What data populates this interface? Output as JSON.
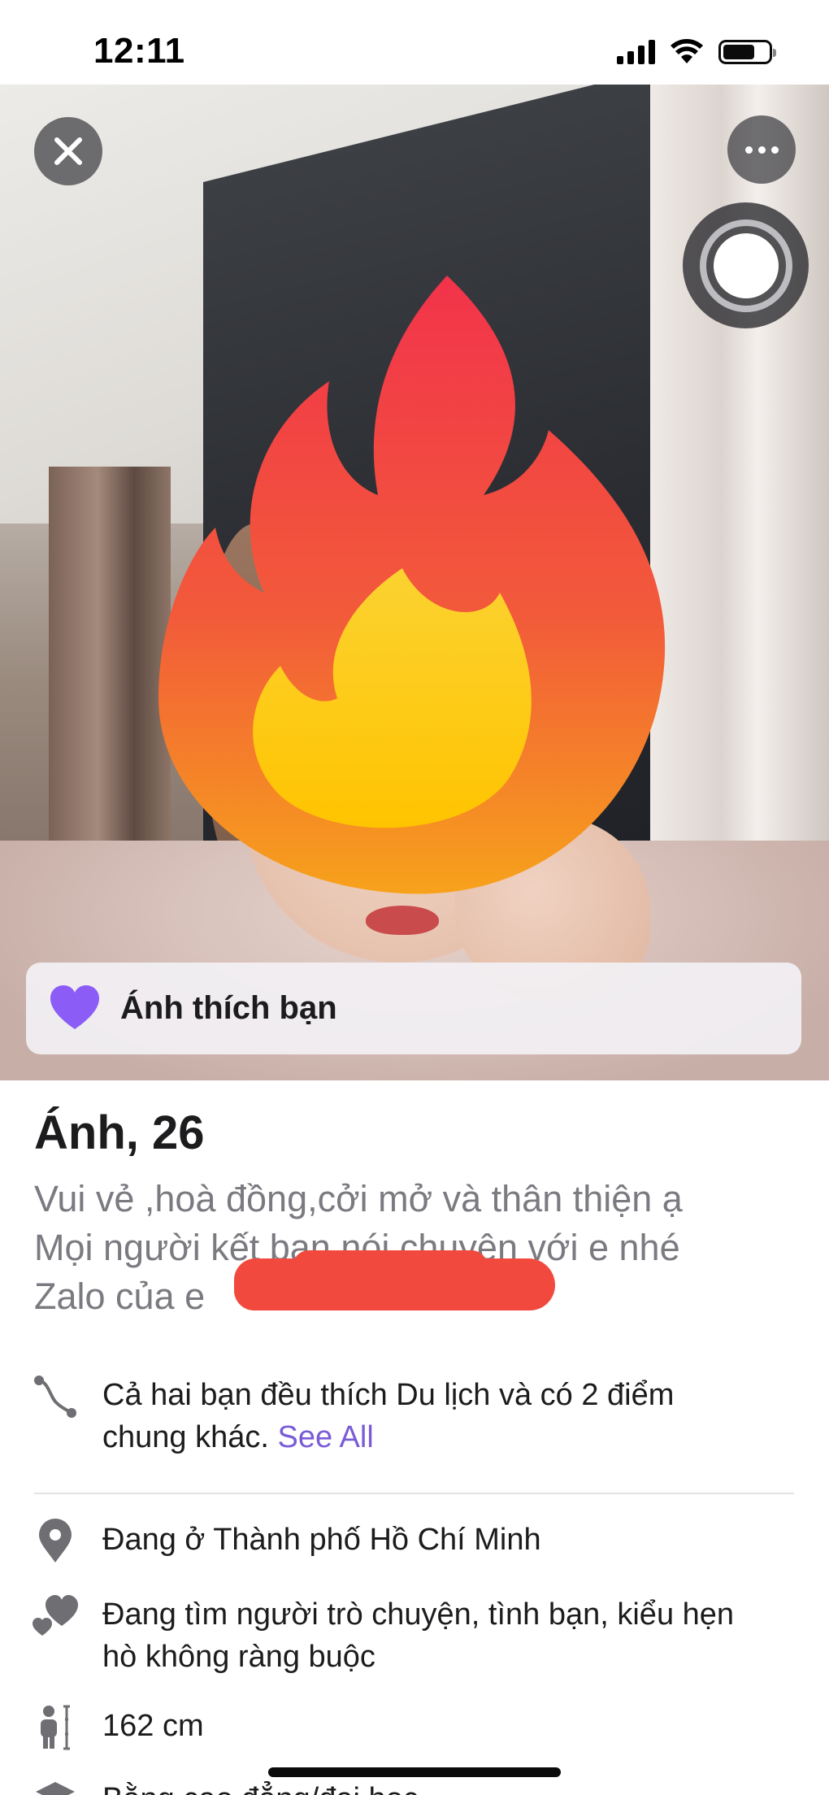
{
  "status_bar": {
    "time": "12:11",
    "signal_icon": "cellular-signal-icon",
    "wifi_icon": "wifi-icon",
    "battery_icon": "battery-icon",
    "battery_level": 0.7
  },
  "photo": {
    "close_icon": "close-icon",
    "more_icon": "more-options-icon",
    "record_icon": "record-button-icon",
    "overlay_icon": "fire-emoji-icon"
  },
  "like_banner": {
    "icon": "heart-icon",
    "text": "Ánh thích bạn",
    "accent_color": "#8b5cf6"
  },
  "profile": {
    "name_age": "Ánh, 26",
    "bio_lines": [
      "Vui vẻ ,hoà đồng,cởi mở và thân thiện ạ",
      "Mọi người kết bạn nói chuyện với e nhé",
      "Zalo của e"
    ]
  },
  "details": {
    "common_text": "Cả hai bạn đều thích Du lịch và có 2 điểm chung khác.",
    "common_line1": "Cả hai bạn đều thích Du lịch và có 2 điểm",
    "common_line2": "chung khác.",
    "see_all": "See All",
    "location": "Đang ở Thành phố Hồ Chí Minh",
    "looking_line1": "Đang tìm người trò chuyện, tình bạn, kiểu hẹn",
    "looking_line2": "hò không ràng buộc",
    "height": "162 cm",
    "cut_line": "Bằng cao đẳng/đại học"
  },
  "colors": {
    "link": "#7a5cd6",
    "redaction": "#f2493e",
    "muted_text": "#7a7a80"
  }
}
